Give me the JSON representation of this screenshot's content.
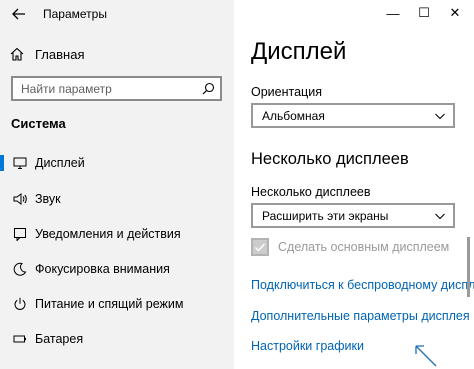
{
  "window": {
    "title": "Параметры",
    "controls": {
      "minimize": "—",
      "maximize": "☐",
      "close": "✕"
    }
  },
  "sidebar": {
    "home_label": "Главная",
    "search": {
      "placeholder": "Найти параметр"
    },
    "section_title": "Система",
    "items": [
      {
        "label": "Дисплей",
        "icon": "display-icon",
        "selected": true
      },
      {
        "label": "Звук",
        "icon": "speaker-icon",
        "selected": false
      },
      {
        "label": "Уведомления и действия",
        "icon": "notification-icon",
        "selected": false
      },
      {
        "label": "Фокусировка внимания",
        "icon": "moon-icon",
        "selected": false
      },
      {
        "label": "Питание и спящий режим",
        "icon": "power-icon",
        "selected": false
      },
      {
        "label": "Батарея",
        "icon": "battery-icon",
        "selected": false
      }
    ]
  },
  "main": {
    "title": "Дисплей",
    "orientation": {
      "label": "Ориентация",
      "value": "Альбомная"
    },
    "multi_display_heading": "Несколько дисплеев",
    "multi_display": {
      "label": "Несколько дисплеев",
      "value": "Расширить эти экраны"
    },
    "make_main_checkbox": {
      "label": "Сделать основным дисплеем",
      "checked": true,
      "disabled": true
    },
    "links": [
      "Подключиться к беспроводному дисплею",
      "Дополнительные параметры дисплея",
      "Настройки графики"
    ]
  },
  "colors": {
    "accent": "#0078d7",
    "link": "#0064b4",
    "sidebar_bg": "#f2f2f2"
  }
}
